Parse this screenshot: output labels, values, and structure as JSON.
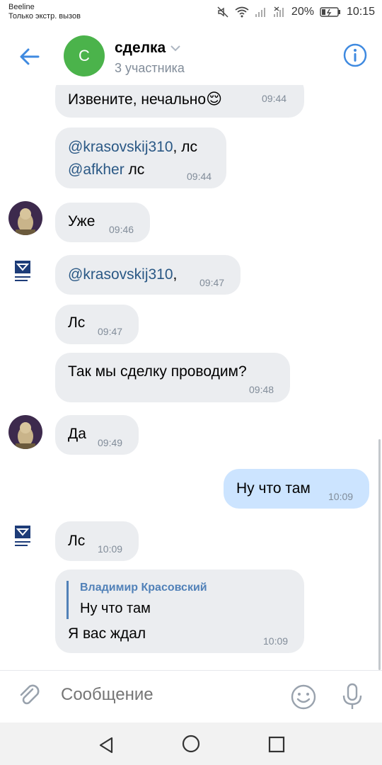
{
  "status_bar": {
    "carrier": "Beeline",
    "emergency": "Только экстр. вызов",
    "battery": "20%",
    "time": "10:15"
  },
  "header": {
    "avatar_letter": "С",
    "title": "сделка",
    "subtitle": "3 участника"
  },
  "messages": [
    {
      "parts": [
        "Извените, нечально"
      ],
      "emoji": "😌",
      "time": "09:44"
    },
    {
      "line1_mention": "@krasovskij310",
      "line1_rest": ", лс",
      "line2_mention": "@afkher",
      "line2_rest": " лс",
      "time": "09:44"
    },
    {
      "text": "Уже",
      "time": "09:46"
    },
    {
      "mention": "@krasovskij310",
      "rest": ",",
      "time": "09:47"
    },
    {
      "text": "Лс",
      "time": "09:47"
    },
    {
      "text": "Так мы сделку проводим?",
      "time": "09:48"
    },
    {
      "text": "Да",
      "time": "09:49"
    },
    {
      "text": "Ну что там",
      "time": "10:09"
    },
    {
      "text": "Лс",
      "time": "10:09"
    },
    {
      "reply_name": "Владимир Красовский",
      "reply_text": "Ну что там",
      "text": "Я вас ждал",
      "time": "10:09"
    }
  ],
  "composer": {
    "placeholder": "Сообщение"
  },
  "colors": {
    "accent": "#3f8ae0",
    "bubble_in": "#ebedf0",
    "bubble_out": "#cce4ff",
    "mention": "#2a5885",
    "avatar_green": "#4bb34b"
  }
}
